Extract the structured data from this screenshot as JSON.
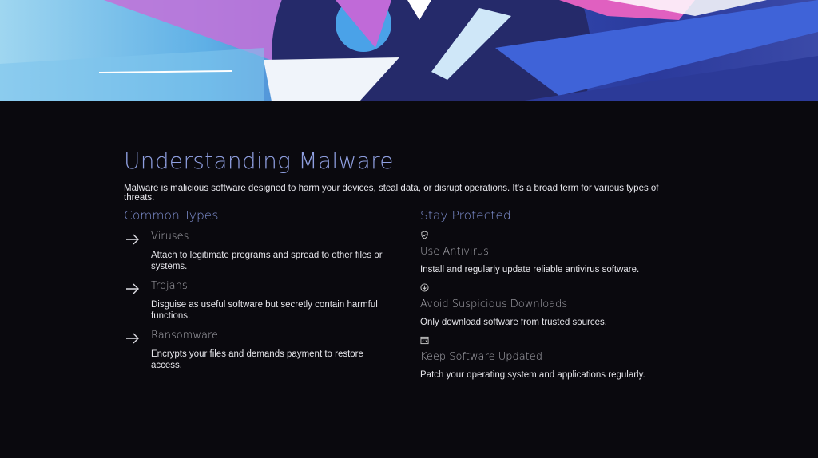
{
  "title": "Understanding Malware",
  "intro": "Malware is malicious software designed to harm your devices, steal data, or disrupt operations. It's a broad term for various types of threats.",
  "types": {
    "heading": "Common Types",
    "items": [
      {
        "name": "Viruses",
        "desc": "Attach to legitimate programs and spread to other files or systems.",
        "icon": "arrow-right-icon"
      },
      {
        "name": "Trojans",
        "desc": "Disguise as useful software but secretly contain harmful functions.",
        "icon": "arrow-right-icon"
      },
      {
        "name": "Ransomware",
        "desc": "Encrypts your files and demands payment to restore access.",
        "icon": "arrow-right-icon"
      }
    ]
  },
  "protect": {
    "heading": "Stay Protected",
    "items": [
      {
        "name": "Use Antivirus",
        "desc": "Install and regularly update reliable antivirus software.",
        "icon": "shield-check-icon"
      },
      {
        "name": "Avoid Suspicious Downloads",
        "desc": "Only download software from trusted sources.",
        "icon": "download-circle-icon"
      },
      {
        "name": "Keep Software Updated",
        "desc": "Patch your operating system and applications regularly.",
        "icon": "code-window-icon"
      }
    ]
  }
}
